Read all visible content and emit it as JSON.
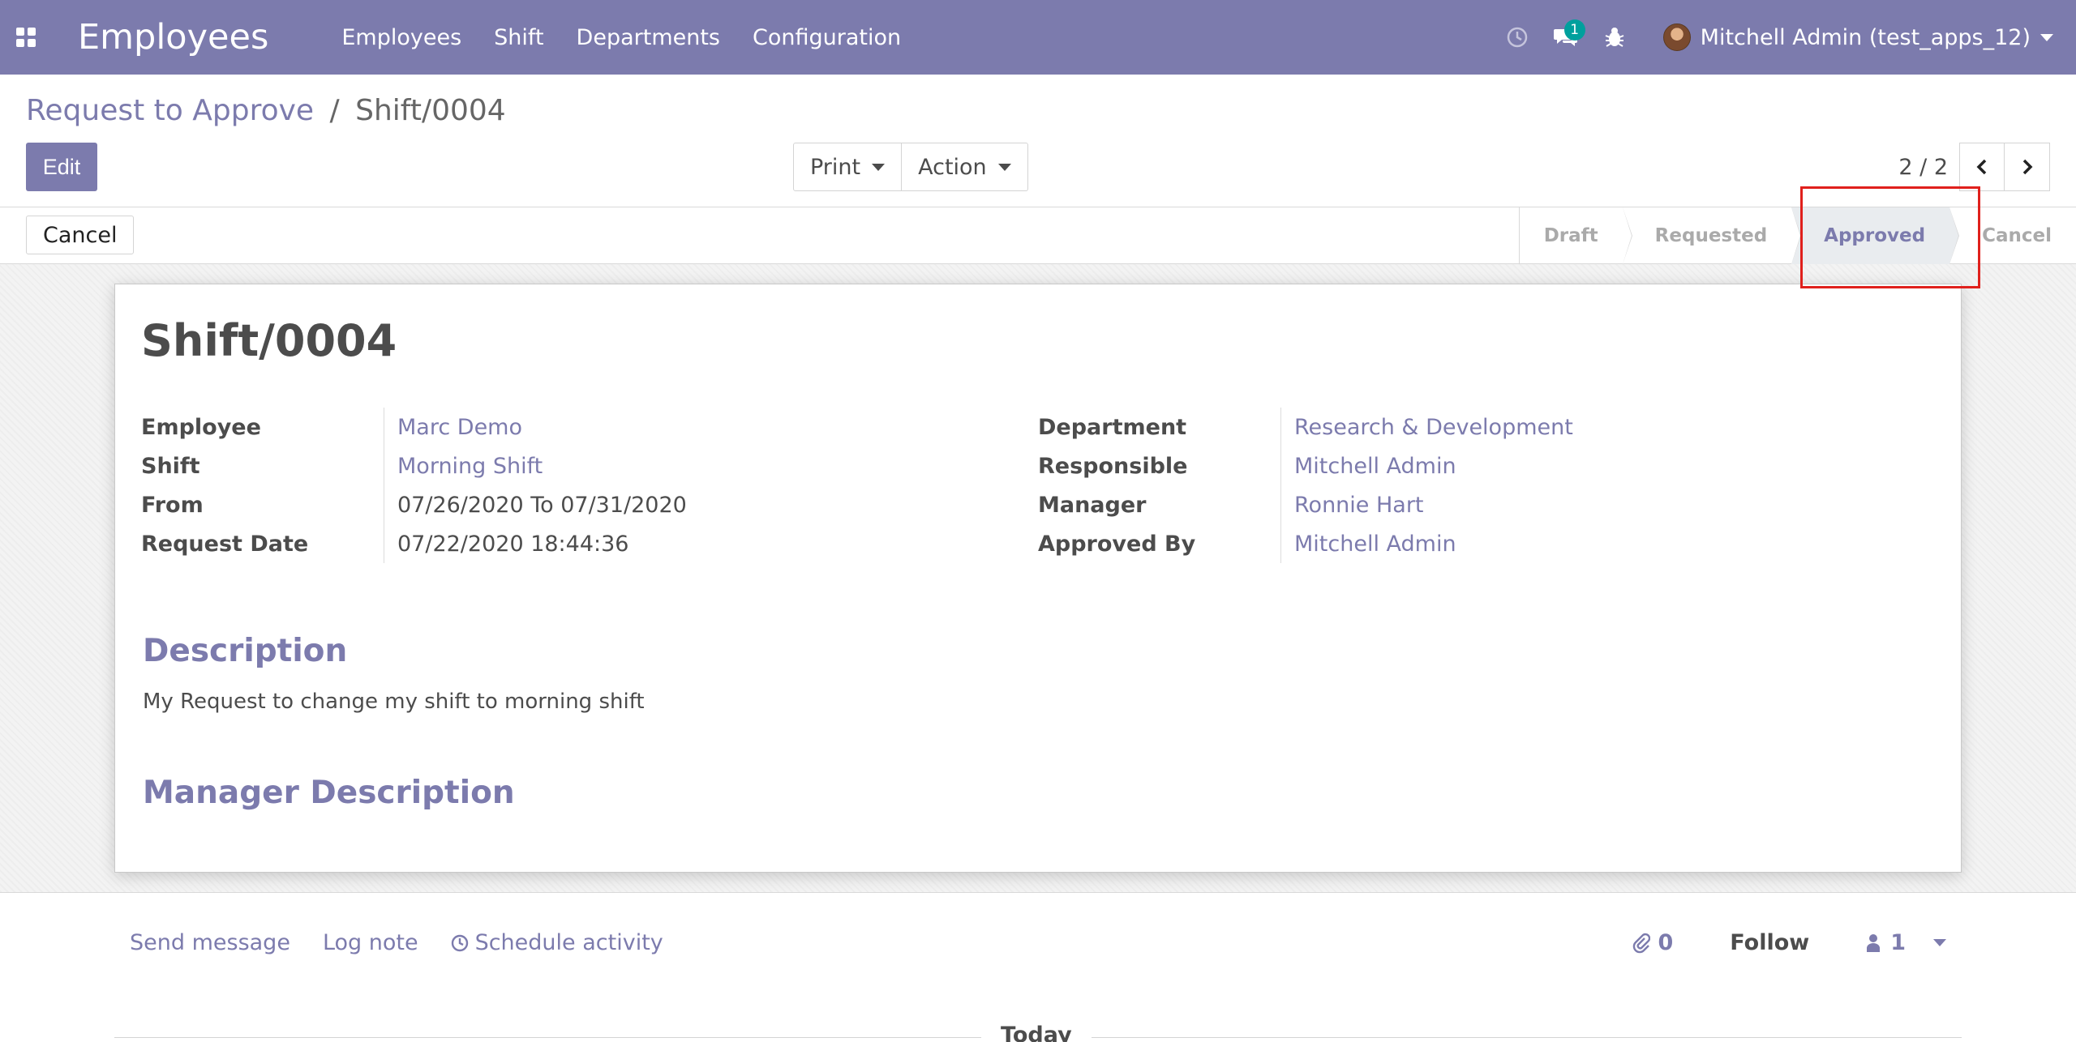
{
  "navbar": {
    "app_name": "Employees",
    "menu": [
      "Employees",
      "Shift",
      "Departments",
      "Configuration"
    ],
    "messages_badge": "1",
    "user_name": "Mitchell Admin (test_apps_12)"
  },
  "breadcrumb": {
    "parent": "Request to Approve",
    "separator": "/",
    "current": "Shift/0004"
  },
  "toolbar": {
    "edit_label": "Edit",
    "print_label": "Print",
    "action_label": "Action",
    "pager_value": "2 / 2"
  },
  "statusbar": {
    "cancel_label": "Cancel",
    "stages": [
      "Draft",
      "Requested",
      "Approved",
      "Cancel"
    ],
    "active_stage": "Approved"
  },
  "record": {
    "title": "Shift/0004",
    "left_fields": [
      {
        "label": "Employee",
        "value": "Marc Demo",
        "link": true
      },
      {
        "label": "Shift",
        "value": "Morning Shift",
        "link": true
      },
      {
        "label": "From",
        "value": "07/26/2020 To 07/31/2020",
        "link": false
      },
      {
        "label": "Request Date",
        "value": "07/22/2020 18:44:36",
        "link": false
      }
    ],
    "right_fields": [
      {
        "label": "Department",
        "value": "Research & Development",
        "link": true
      },
      {
        "label": "Responsible",
        "value": "Mitchell Admin",
        "link": true
      },
      {
        "label": "Manager",
        "value": "Ronnie Hart",
        "link": true
      },
      {
        "label": "Approved By",
        "value": "Mitchell Admin",
        "link": true
      }
    ],
    "description_title": "Description",
    "description_text": "My Request to change my shift to morning shift",
    "manager_description_title": "Manager Description"
  },
  "chatter": {
    "send_message": "Send message",
    "log_note": "Log note",
    "schedule_activity": "Schedule activity",
    "attachments_count": "0",
    "follow_label": "Follow",
    "followers_count": "1",
    "today_label": "Today"
  },
  "colors": {
    "brand": "#7c7bad",
    "badge": "#00a09d",
    "highlight": "#e0201c"
  }
}
